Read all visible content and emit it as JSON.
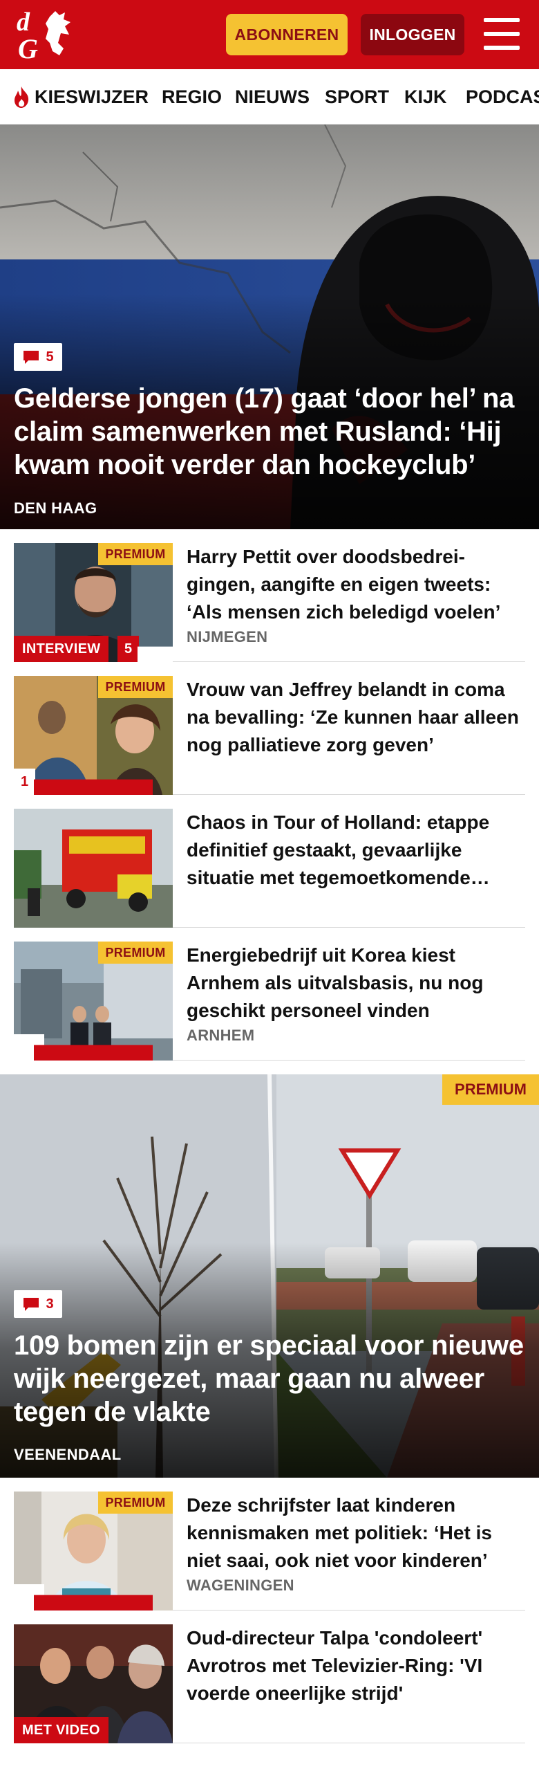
{
  "header": {
    "logo_text": "dG",
    "subscribe_label": "ABONNEREN",
    "login_label": "INLOGGEN"
  },
  "nav": {
    "items": [
      "KIESWIJZER",
      "REGIO",
      "NIEUWS",
      "SPORT",
      "KIJK",
      "PODCAS"
    ]
  },
  "hero1": {
    "comments": "5",
    "title": "Gelderse jongen (17) gaat ‘door hel’ na claim samenwerken met Rusland: ‘Hij kwam nooit verder dan hockeyclub’",
    "location": "DEN HAAG"
  },
  "articles": [
    {
      "premium_label": "PREMIUM",
      "tag": "INTERVIEW",
      "comments": "5",
      "title": "Harry Pettit over doodsbedrei­gingen, aangifte en eigen tweets: ‘Als mensen zich beledigd voelen’",
      "location": "NIJMEGEN"
    },
    {
      "premium_label": "PREMIUM",
      "comments": "1",
      "title": "Vrouw van Jeffrey belandt in coma na bevalling: ‘Ze kunnen haar alleen nog palliatieve zorg geven’"
    },
    {
      "title": "Chaos in Tour of Holland: etappe definitief gestaakt, gevaarlijke situatie met tegemoetkomende verkeer"
    },
    {
      "premium_label": "PREMIUM",
      "title": "Energiebedrijf uit Korea kiest Arnhem als uitvalsbasis, nu nog geschikt personeel vinden",
      "location": "ARNHEM"
    }
  ],
  "hero2": {
    "premium_label": "PREMIUM",
    "comments": "3",
    "title": "109 bomen zijn er speciaal voor nieuwe wijk neergezet, maar gaan nu alweer tegen de vlakte",
    "location": "VEENENDAAL"
  },
  "articles2": [
    {
      "premium_label": "PREMIUM",
      "title": "Deze schrijfster laat kinderen kennismaken met politiek: ‘Het is niet saai, ook niet voor kinderen’",
      "location": "WAGENINGEN"
    },
    {
      "tag": "MET VIDEO",
      "title": "Oud-directeur Talpa 'condoleert' Avrotros met Televizier-Ring: 'VI voerde oneerlijke strijd'"
    }
  ],
  "colors": {
    "brand_red": "#cc0a13",
    "premium_yellow": "#f5c232",
    "login_dark_red": "#8c0710"
  },
  "icons": [
    "flame-icon",
    "comment-icon",
    "menu-icon"
  ]
}
